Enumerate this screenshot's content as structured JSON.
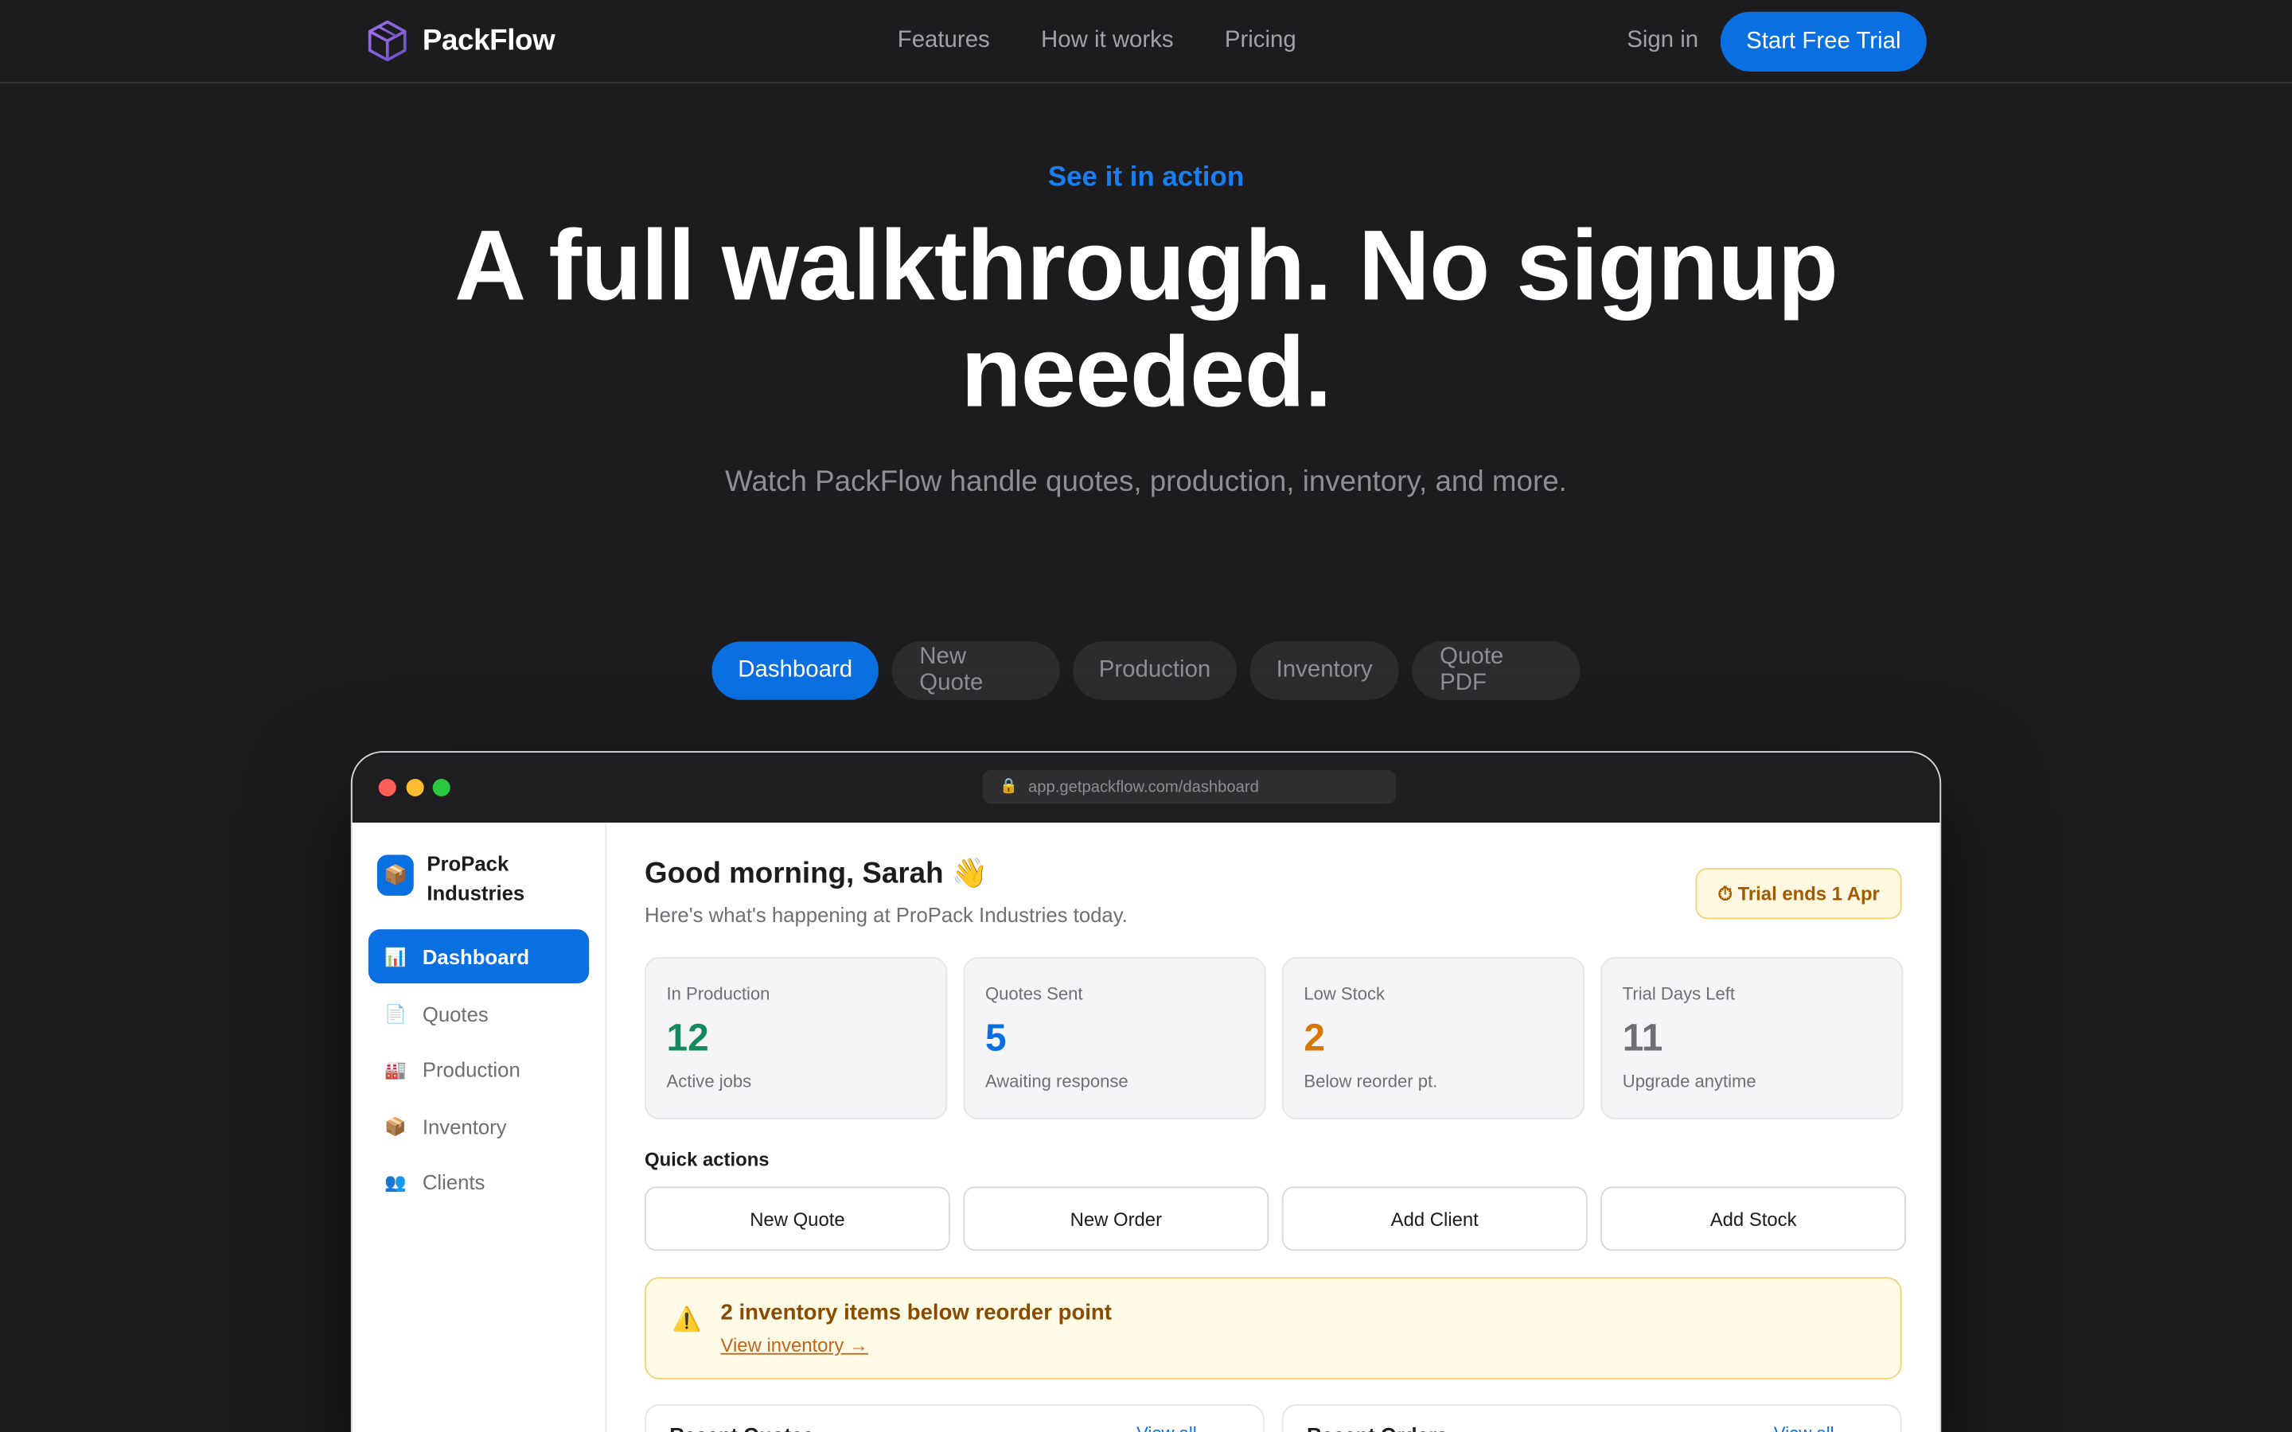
{
  "nav": {
    "brand": "PackFlow",
    "links": [
      "Features",
      "How it works",
      "Pricing"
    ],
    "signin": "Sign in",
    "cta": "Start Free Trial"
  },
  "hero": {
    "eyebrow": "See it in action",
    "title": "A full walkthrough. No signup needed.",
    "subtitle": "Watch PackFlow handle quotes, production, inventory, and more."
  },
  "tabs": [
    "Dashboard",
    "New Quote",
    "Production",
    "Inventory",
    "Quote PDF"
  ],
  "browser": {
    "url": "app.getpackflow.com/dashboard"
  },
  "app": {
    "org_name": "ProPack Industries",
    "sidebar": [
      {
        "label": "Dashboard",
        "icon": "bar-chart-icon",
        "glyph": "📊"
      },
      {
        "label": "Quotes",
        "icon": "document-icon",
        "glyph": "📄"
      },
      {
        "label": "Production",
        "icon": "factory-icon",
        "glyph": "🏭"
      },
      {
        "label": "Inventory",
        "icon": "box-icon",
        "glyph": "📦"
      },
      {
        "label": "Clients",
        "icon": "people-icon",
        "glyph": "👥"
      }
    ],
    "greeting": "Good morning, Sarah 👋",
    "greeting_sub": "Here's what's happening at ProPack Industries today.",
    "trial_badge": "⏱ Trial ends 1 Apr",
    "stats": [
      {
        "label": "In Production",
        "value": "12",
        "sub": "Active jobs",
        "color": "#138a5c"
      },
      {
        "label": "Quotes Sent",
        "value": "5",
        "sub": "Awaiting response",
        "color": "#0a6fe0"
      },
      {
        "label": "Low Stock",
        "value": "2",
        "sub": "Below reorder pt.",
        "color": "#d97706"
      },
      {
        "label": "Trial Days Left",
        "value": "11",
        "sub": "Upgrade anytime",
        "color": "#6e6e73"
      }
    ],
    "quick_actions_title": "Quick actions",
    "quick_actions": [
      "New Quote",
      "New Order",
      "Add Client",
      "Add Stock"
    ],
    "alert": {
      "title": "2 inventory items below reorder point",
      "link": "View inventory →"
    },
    "panels": [
      {
        "title": "Recent Quotes",
        "link": "View all →"
      },
      {
        "title": "Recent Orders",
        "link": "View all →"
      }
    ]
  }
}
